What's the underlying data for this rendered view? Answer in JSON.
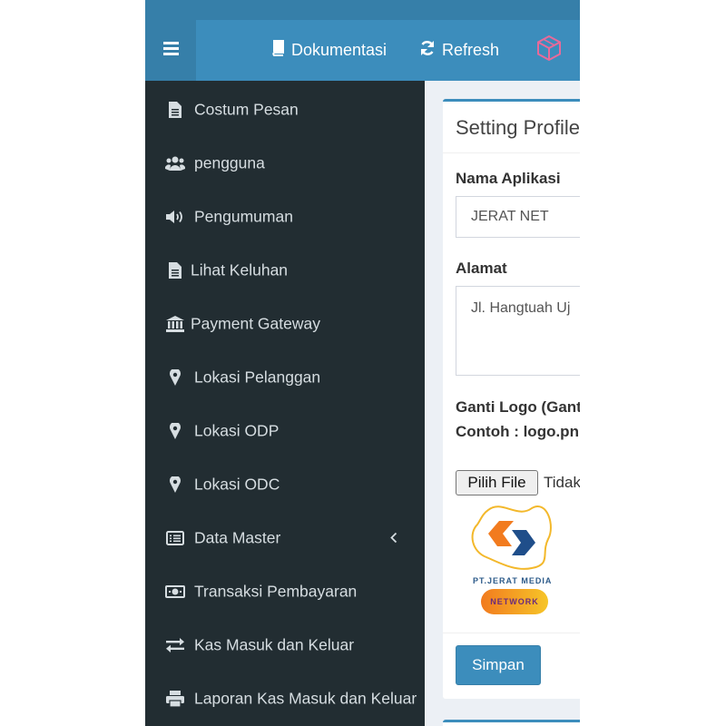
{
  "header": {
    "docs_label": "Dokumentasi",
    "refresh_label": "Refresh"
  },
  "sidebar": {
    "items": [
      {
        "label": "Costum Pesan",
        "icon": "file-icon"
      },
      {
        "label": "pengguna",
        "icon": "users-icon"
      },
      {
        "label": "Pengumuman",
        "icon": "volume-icon"
      },
      {
        "label": "Lihat Keluhan",
        "icon": "file-icon"
      },
      {
        "label": "Payment Gateway",
        "icon": "bank-icon"
      },
      {
        "label": "Lokasi Pelanggan",
        "icon": "map-marker-icon"
      },
      {
        "label": "Lokasi ODP",
        "icon": "map-marker-icon"
      },
      {
        "label": "Lokasi ODC",
        "icon": "map-marker-icon"
      },
      {
        "label": "Data Master",
        "icon": "list-icon"
      },
      {
        "label": "Transaksi Pembayaran",
        "icon": "money-icon"
      },
      {
        "label": "Kas Masuk dan Keluar",
        "icon": "exchange-icon"
      },
      {
        "label": "Laporan Kas Masuk dan Keluar",
        "icon": "print-icon"
      }
    ]
  },
  "form": {
    "title": "Setting Profile",
    "app_name_label": "Nama Aplikasi",
    "app_name_value": "JERAT NET",
    "address_label": "Alamat",
    "address_value": "Jl. Hangtuah Uj",
    "logo_label": "Ganti Logo (Gant",
    "logo_example": "Contoh : logo.pn",
    "file_button": "Pilih File",
    "file_status": "Tidak",
    "save_label": "Simpan"
  },
  "logo": {
    "company": "PT.JERAT MEDIA",
    "tagline": "NETWORK"
  },
  "colors": {
    "header": "#3c8dbc",
    "sidebar": "#222d32",
    "accent": "#3c8dbc"
  }
}
